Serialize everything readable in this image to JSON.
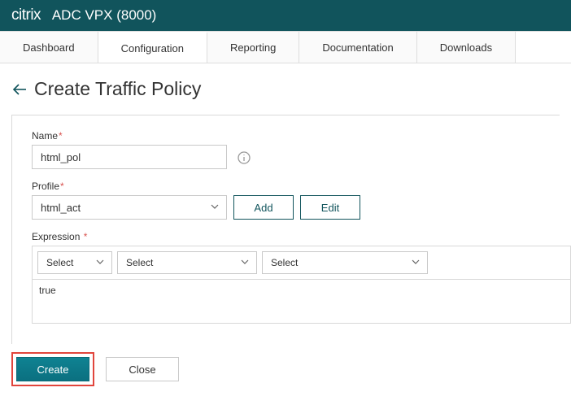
{
  "header": {
    "brand": "citrix",
    "product": "ADC VPX (8000)"
  },
  "tabs": {
    "dashboard": "Dashboard",
    "configuration": "Configuration",
    "reporting": "Reporting",
    "documentation": "Documentation",
    "downloads": "Downloads"
  },
  "page": {
    "title": "Create Traffic Policy"
  },
  "form": {
    "name_label": "Name",
    "name_value": "html_pol",
    "profile_label": "Profile",
    "profile_value": "html_act",
    "add_label": "Add",
    "edit_label": "Edit",
    "expression_label": "Expression",
    "select_placeholder": "Select",
    "expression_value": "true"
  },
  "buttons": {
    "create": "Create",
    "close": "Close"
  }
}
